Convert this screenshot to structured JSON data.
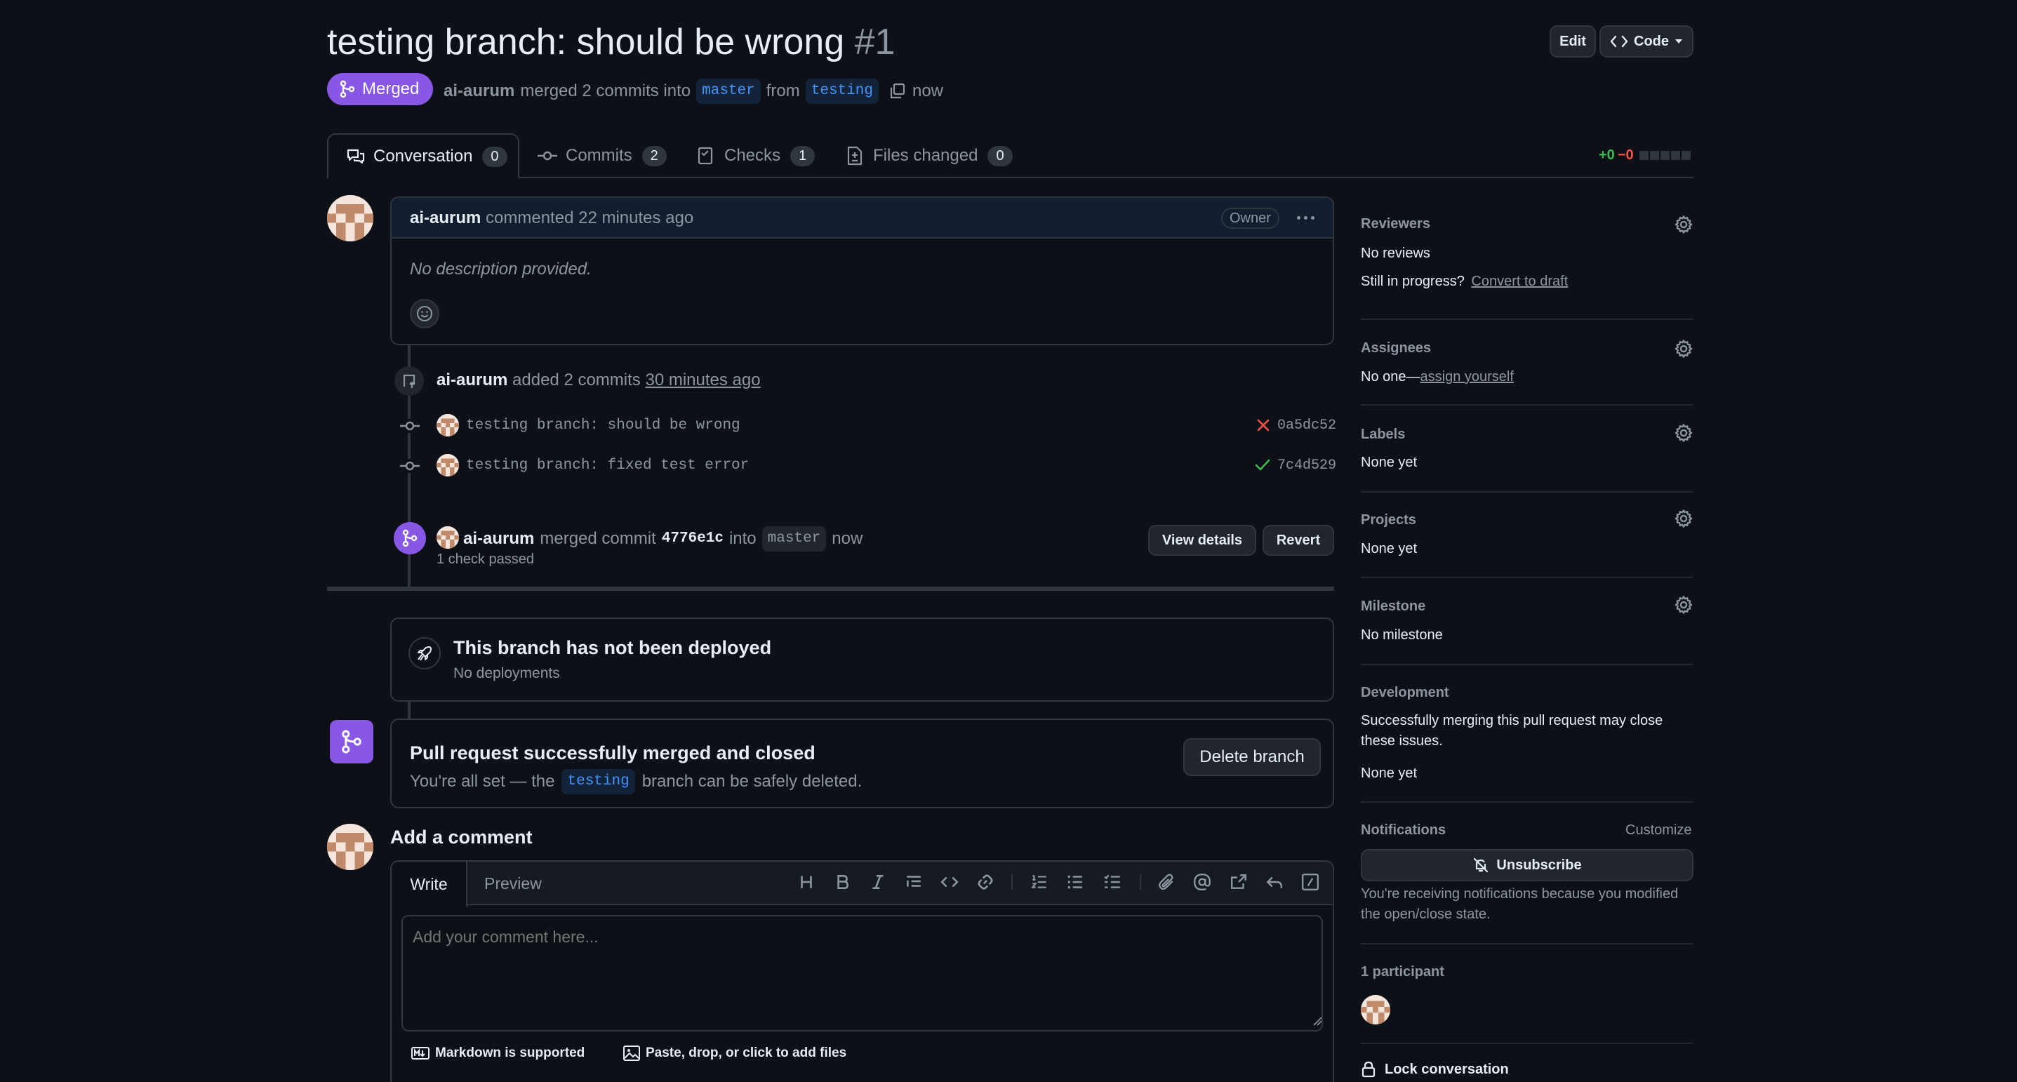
{
  "header": {
    "title": "testing branch: should be wrong",
    "number": "#1",
    "edit_label": "Edit",
    "code_label": "Code",
    "status_label": "Merged",
    "author": "ai-aurum",
    "merged_text": "merged 2 commits into",
    "base_branch": "master",
    "from_text": "from",
    "head_branch": "testing",
    "time": "now"
  },
  "tabs": [
    {
      "label": "Conversation",
      "count": "0"
    },
    {
      "label": "Commits",
      "count": "2"
    },
    {
      "label": "Checks",
      "count": "1"
    },
    {
      "label": "Files changed",
      "count": "0"
    }
  ],
  "diffstat": {
    "added": "+0",
    "removed": "−0"
  },
  "comment": {
    "author": "ai-aurum",
    "action": "commented 22 minutes ago",
    "role": "Owner",
    "body": "No description provided."
  },
  "commits_event": {
    "author": "ai-aurum",
    "text": "added 2 commits",
    "time": "30 minutes ago",
    "commits": [
      {
        "message": "testing branch: should be wrong",
        "sha": "0a5dc52",
        "status": "fail"
      },
      {
        "message": "testing branch: fixed test error",
        "sha": "7c4d529",
        "status": "pass"
      }
    ]
  },
  "merge_event": {
    "author": "ai-aurum",
    "text": "merged commit",
    "sha": "4776e1c",
    "into": "into",
    "branch": "master",
    "time": "now",
    "checks": "1 check passed",
    "view_details": "View details",
    "revert": "Revert"
  },
  "deploy": {
    "title": "This branch has not been deployed",
    "subtitle": "No deployments"
  },
  "merged_box": {
    "title": "Pull request successfully merged and closed",
    "prefix": "You're all set — the",
    "branch": "testing",
    "suffix": "branch can be safely deleted.",
    "delete_label": "Delete branch"
  },
  "add_comment": {
    "heading": "Add a comment",
    "write_tab": "Write",
    "preview_tab": "Preview",
    "placeholder": "Add your comment here...",
    "markdown_note": "Markdown is supported",
    "files_note": "Paste, drop, or click to add files"
  },
  "sidebar": {
    "reviewers": {
      "heading": "Reviewers",
      "value": "No reviews",
      "progress_q": "Still in progress?",
      "convert": "Convert to draft"
    },
    "assignees": {
      "heading": "Assignees",
      "value_prefix": "No one—",
      "assign": "assign yourself"
    },
    "labels": {
      "heading": "Labels",
      "value": "None yet"
    },
    "projects": {
      "heading": "Projects",
      "value": "None yet"
    },
    "milestone": {
      "heading": "Milestone",
      "value": "No milestone"
    },
    "development": {
      "heading": "Development",
      "desc_line1": "Successfully merging this pull request may close",
      "desc_line2": "these issues.",
      "value": "None yet"
    },
    "notifications": {
      "heading": "Notifications",
      "customize": "Customize",
      "unsubscribe": "Unsubscribe",
      "reason_line1": "You're receiving notifications because you modified",
      "reason_line2": "the open/close state."
    },
    "participants": {
      "heading": "1 participant"
    },
    "lock": "Lock conversation"
  },
  "colors": {
    "merged": "#8957e5",
    "link": "#4493f8",
    "success": "#3fb950",
    "danger": "#f85149",
    "bg": "#0d1117"
  }
}
